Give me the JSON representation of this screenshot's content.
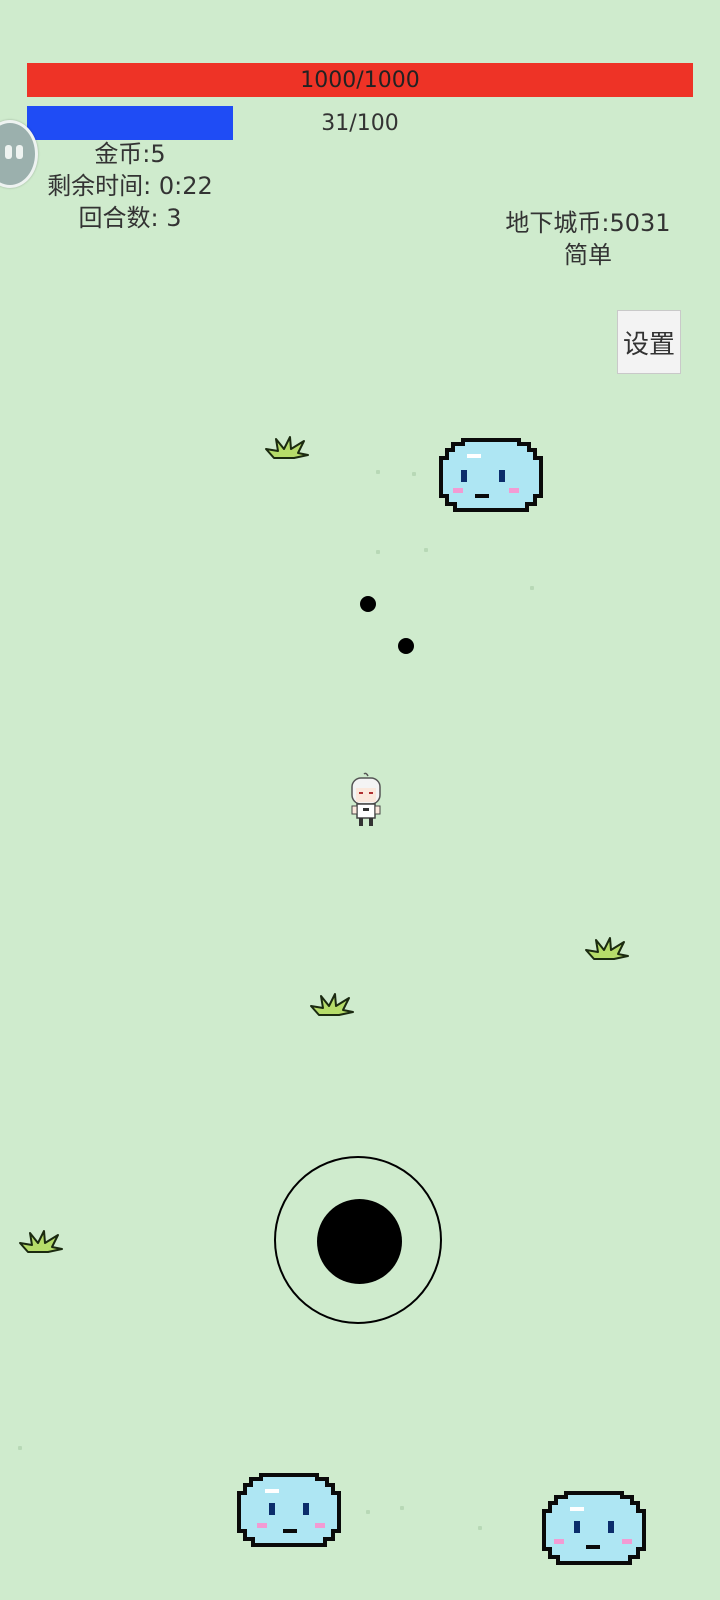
{
  "hud": {
    "hp_text": "1000/1000",
    "hp_fraction": 1.0,
    "mp_text": "31/100",
    "mp_fraction": 0.31,
    "hp_color": "#ee3326",
    "mp_color": "#1f4cf5"
  },
  "stats": {
    "coins": "金币:5",
    "time_left": "剩余时间: 0:22",
    "rounds": "回合数: 3"
  },
  "dungeon": {
    "coins": "地下城币:5031",
    "difficulty": "简单"
  },
  "settings": {
    "label": "设置"
  },
  "icons": {
    "floating_button": "pause-bubble-icon",
    "grass": "grass-tuft-icon",
    "enemy": "blue-slime-icon",
    "player": "white-haired-hero-icon",
    "bullet": "black-bullet-icon"
  },
  "colors": {
    "background": "#cfebcd",
    "slime_fill": "#aee6f3",
    "slime_outline": "#0a0a0a",
    "grass_fill": "#b6dc6a"
  }
}
